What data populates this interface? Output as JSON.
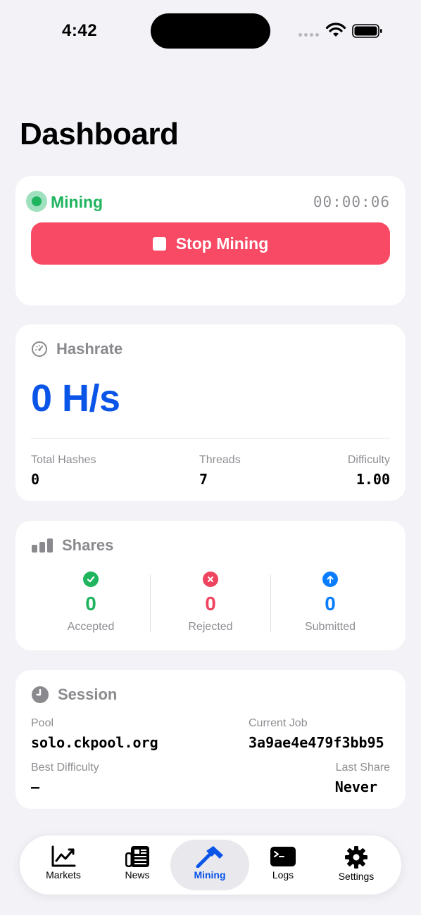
{
  "status_bar": {
    "time": "4:42"
  },
  "page": {
    "title": "Dashboard"
  },
  "mining": {
    "status": "Mining",
    "timer": "00:00:06",
    "stop_label": "Stop Mining",
    "status_color": "#1fb45e",
    "button_color": "#f84a64"
  },
  "hashrate": {
    "title": "Hashrate",
    "value": "0 H/s",
    "value_color": "#0a55e8",
    "stats": [
      {
        "label": "Total Hashes",
        "value": "0"
      },
      {
        "label": "Threads",
        "value": "7"
      },
      {
        "label": "Difficulty",
        "value": "1.00"
      }
    ]
  },
  "shares": {
    "title": "Shares",
    "items": [
      {
        "label": "Accepted",
        "value": "0",
        "color": "#1fb45e",
        "icon": "checkmark-circle-icon"
      },
      {
        "label": "Rejected",
        "value": "0",
        "color": "#ef4460",
        "icon": "xmark-circle-icon"
      },
      {
        "label": "Submitted",
        "value": "0",
        "color": "#0a7dff",
        "icon": "arrow-up-circle-icon"
      }
    ]
  },
  "session": {
    "title": "Session",
    "pool_label": "Pool",
    "pool_value": "solo.ckpool.org",
    "job_label": "Current Job",
    "job_value": "3a9ae4e479f3bb95",
    "best_label": "Best Difficulty",
    "best_value": "—",
    "last_label": "Last Share",
    "last_value": "Never"
  },
  "tabs": [
    {
      "label": "Markets",
      "icon": "chart-line-icon",
      "active": false
    },
    {
      "label": "News",
      "icon": "newspaper-icon",
      "active": false
    },
    {
      "label": "Mining",
      "icon": "hammer-icon",
      "active": true
    },
    {
      "label": "Logs",
      "icon": "terminal-icon",
      "active": false
    },
    {
      "label": "Settings",
      "icon": "gear-icon",
      "active": false
    }
  ]
}
